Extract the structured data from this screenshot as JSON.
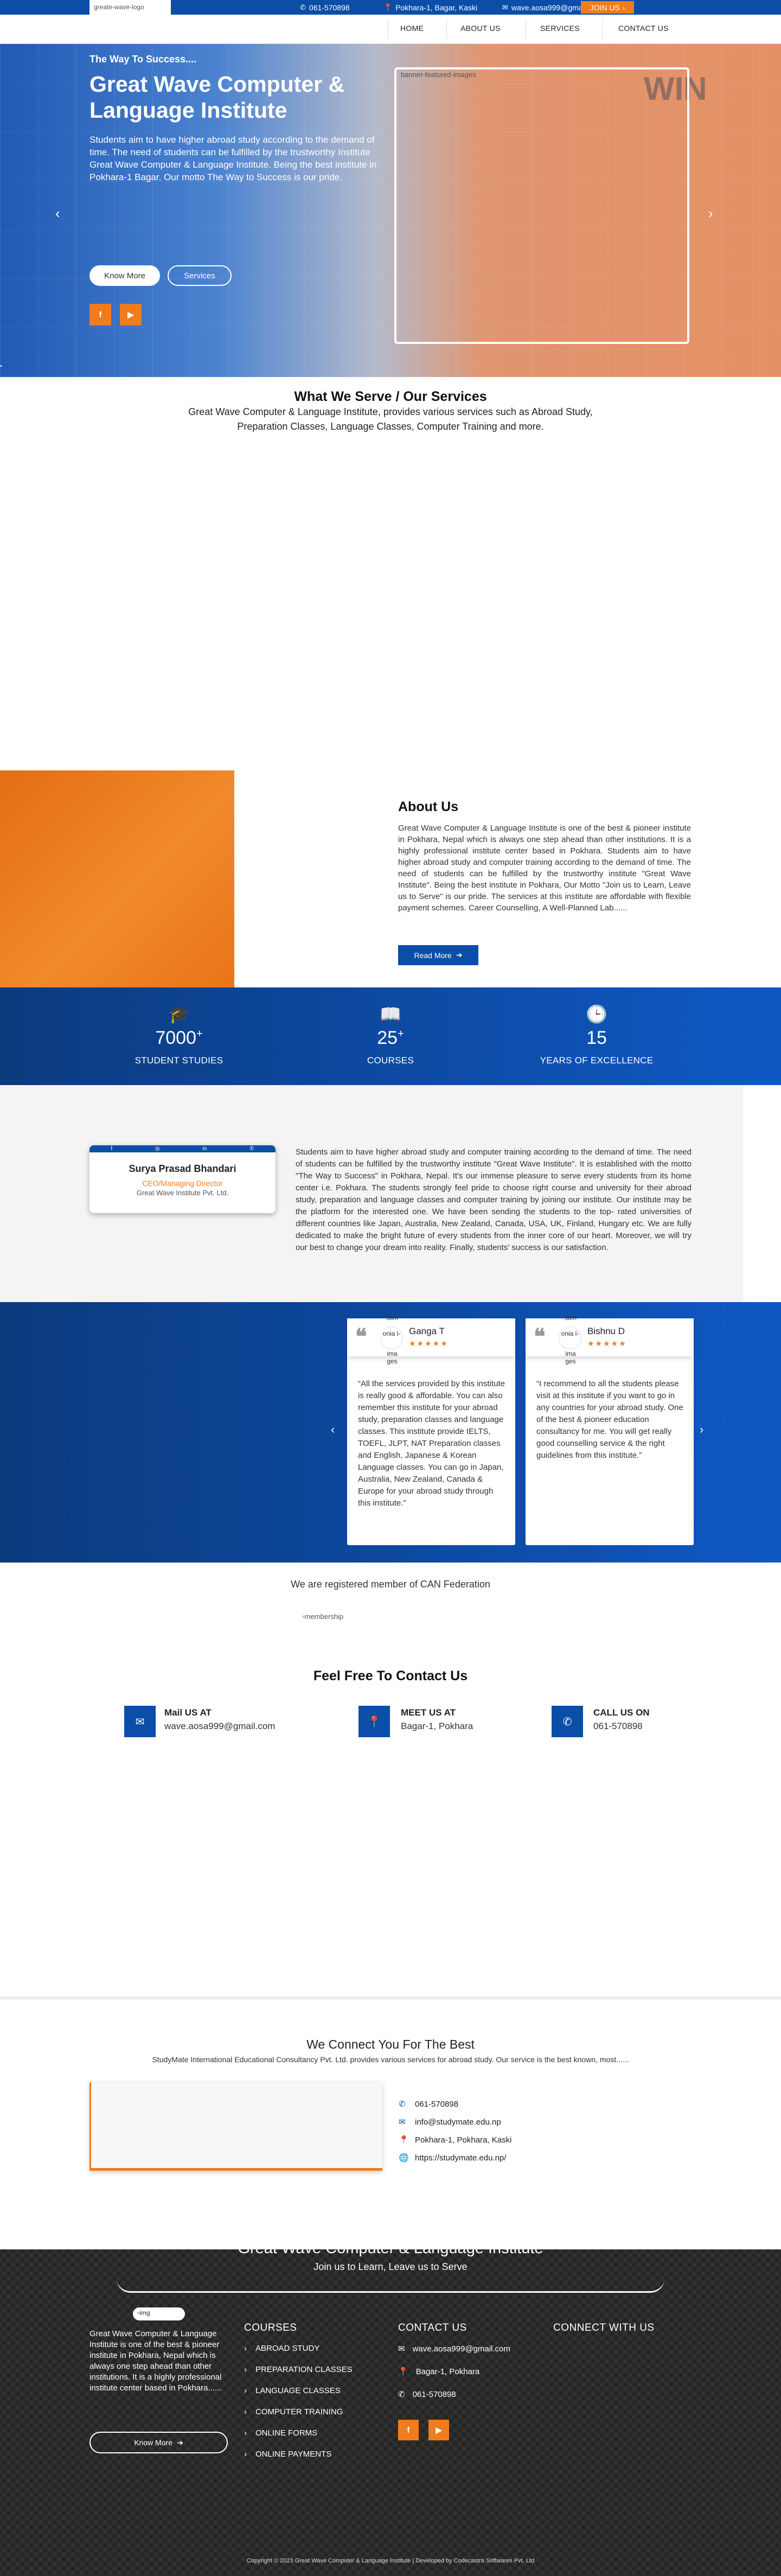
{
  "topbar": {
    "logo_alt": "greate-wave-logo",
    "phone": "061-570898",
    "address": "Pokhara-1, Bagar, Kaski",
    "email": "wave.aosa999@gmail.com",
    "join": "JOIN US"
  },
  "nav": {
    "items": [
      "HOME",
      "ABOUT US",
      "SERVICES",
      "CONTACT US"
    ]
  },
  "hero": {
    "kicker": "The Way To Success....",
    "title": "Great Wave Computer & Language Institute",
    "text": "Students aim to have higher abroad study according to the demand of time. The need of students can be fulfilled by the trustworthy Institute Great Wave Computer & Language Institute. Being the best institute in Pokhara-1 Bagar. Our motto The Way to Success is our pride.",
    "btn_know": "Know More",
    "btn_services": "Services",
    "frame_alt": "banner-featured-images",
    "watermark": "WIN",
    "prev": "‹",
    "next": "›",
    "corner": "▪"
  },
  "services": {
    "title": "What We Serve / Our Services",
    "subtitle": "Great Wave Computer & Language Institute, provides various services such as Abroad Study, Preparation Classes, Language Classes, Computer Training and more."
  },
  "about": {
    "title": "About Us",
    "text": "Great Wave Computer & Language Institute is one of the best & pioneer institute in Pokhara, Nepal which is always one step ahead than other institutions. It is a highly professional institute center based in Pokhara. Students aim to have higher abroad study and computer training according to the demand of time. The need of students can be fulfilled by the trustworthy institute \"Great Wave Institute\". Being the best institute in Pokhara, Our Motto \"Join us to Learn, Leave us to Serve\" is our pride. The services at this institute are affordable with flexible payment schemes. Career Counselling, A Well-Planned Lab......",
    "button": "Read More"
  },
  "stats": [
    {
      "icon": "graduation-cap-icon",
      "glyph": "🎓",
      "number": "7000",
      "suffix": "+",
      "label": "STUDENT STUDIES"
    },
    {
      "icon": "book-icon",
      "glyph": "📖",
      "number": "25",
      "suffix": "+",
      "label": "COURSES"
    },
    {
      "icon": "clock-icon",
      "glyph": "🕒",
      "number": "15",
      "suffix": "",
      "label": "YEARS OF EXCELLENCE"
    }
  ],
  "director": {
    "social": [
      "f",
      "◎",
      "in",
      "✆"
    ],
    "name": "Surya Prasad Bhandari",
    "role": "CEO/Managing Director",
    "org": "Great Wave Institute Pvt. Ltd.",
    "text": "Students aim to have higher abroad study and computer training according to the demand of time. The need of students can be fulfilled by the trustworthy institute \"Great Wave Institute\". It is established with the motto \"The Way to Success\" in Pokhara, Nepal. It's our immense pleasure to serve every students from its home center i.e. Pokhara. The students strongly feel pride to choose right course and university for their abroad study, preparation and language classes and computer training by joining our institute. Our institute may be the platform for the interested one. We have been sending the students to the top- rated universities of different countries like Japan, Australia, New Zealand, Canada, USA, UK, Finland, Hungary etc. We are fully dedicated to make the bright future of every students from the inner core of our heart. Moreover, we will try our best to change your dream into reality. Finally, students' success is our satisfaction."
  },
  "testimonials": {
    "prev": "‹",
    "next": "›",
    "items": [
      {
        "name": "Ganga T",
        "stars": "★★★★★",
        "alt_top": "stim",
        "alt_mid": "onia l-",
        "alt_bottom": "ima ges",
        "quote": "“All the services provided by this institute is really good & affordable. You can also remember this institute for your abroad study, preparation classes and language classes. This institute provide IELTS, TOEFL, JLPT, NAT Preparation classes and English, Japanese & Korean Language classes. You can go in Japan, Australia, New Zealand, Canada & Europe for your abroad study through this institute.”"
      },
      {
        "name": "Bishnu D",
        "stars": "★★★★★",
        "alt_top": "stim",
        "alt_mid": "onia l-",
        "alt_bottom": "ima ges",
        "quote": "“I recommend to all the students please visit at this institute if you want to go in any countries for your abroad study. One of the best & pioneer education consultancy for me. You will get really good counselling service & the right guidelines from this institute.”"
      }
    ]
  },
  "membership": {
    "title": "We are registered member of CAN Federation",
    "img_alt": "membership"
  },
  "contact": {
    "title": "Feel Free To Contact Us",
    "items": [
      {
        "icon": "mail-icon",
        "glyph": "✉",
        "label": "Mail US AT",
        "value": "wave.aosa999@gmail.com"
      },
      {
        "icon": "location-icon",
        "glyph": "📍",
        "label": "MEET US AT",
        "value": "Bagar-1, Pokhara"
      },
      {
        "icon": "phone-icon",
        "glyph": "✆",
        "label": "CALL US ON",
        "value": "061-570898"
      }
    ]
  },
  "connect": {
    "title": "We Connect You For The Best",
    "subtitle": "StudyMate International Educational Consultancy Pvt. Ltd. provides various services for abroad study. Our service is the best known, most......",
    "items": [
      {
        "icon": "phone-icon",
        "glyph": "✆",
        "text": "061-570898"
      },
      {
        "icon": "mail-icon",
        "glyph": "✉",
        "text": "info@studymate.edu.np"
      },
      {
        "icon": "location-icon",
        "glyph": "📍",
        "text": "Pokhara-1, Pokhara, Kaski"
      },
      {
        "icon": "globe-icon",
        "glyph": "🌐",
        "text": "https://studymate.edu.np/"
      }
    ]
  },
  "footer": {
    "brand": "Great Wave Computer & Language Institute",
    "tagline": "Join us to Learn, Leave us to Serve",
    "logo_alt": "img",
    "about": "Great Wave Computer & Language Institute is one of the best & pioneer institute in Pokhara, Nepal which is always one step ahead than other institutions. It is a highly professional institute center based in Pokhara......",
    "know_more": "Know More",
    "courses_title": "COURSES",
    "courses": [
      "ABROAD STUDY",
      "PREPARATION CLASSES",
      "LANGUAGE CLASSES",
      "COMPUTER TRAINING",
      "ONLINE FORMS",
      "ONLINE PAYMENTS"
    ],
    "contact_title": "CONTACT US",
    "contact": [
      {
        "icon": "mail-icon",
        "glyph": "✉",
        "text": "wave.aosa999@gmail.com"
      },
      {
        "icon": "location-icon",
        "glyph": "📍",
        "text": "Bagar-1, Pokhara"
      },
      {
        "icon": "phone-icon",
        "glyph": "✆",
        "text": "061-570898"
      }
    ],
    "connect_title": "CONNECT WITH US",
    "social": [
      "f",
      "▶"
    ],
    "copyright": "Copyright © 2023 Great Wave Computer & Language Institute | Developed by Codecastra Softwares Pvt. Ltd"
  },
  "colors": {
    "primary": "#0a4ea8",
    "accent": "#f07c1d",
    "footer": "#232323"
  }
}
